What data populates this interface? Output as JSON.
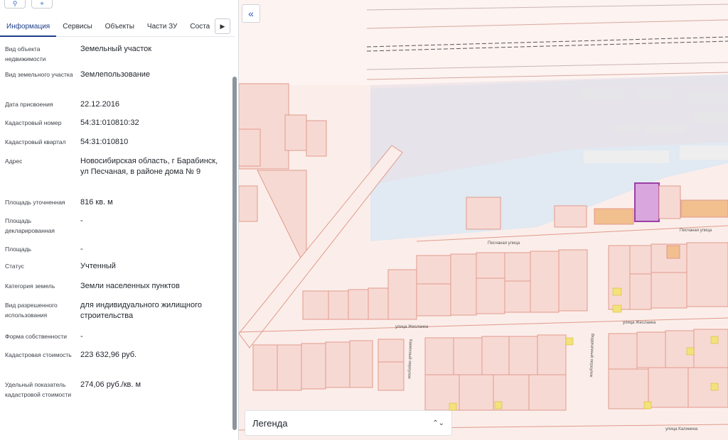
{
  "toolbar": {
    "zoom_icon": "zoom-in-icon",
    "pin_icon": "pin-icon"
  },
  "tabs": [
    {
      "label": "Информация",
      "active": true
    },
    {
      "label": "Сервисы",
      "active": false
    },
    {
      "label": "Объекты",
      "active": false
    },
    {
      "label": "Части ЗУ",
      "active": false
    },
    {
      "label": "Соста",
      "active": false
    }
  ],
  "info": [
    {
      "label": "Вид объекта недвижимости",
      "value": "Земельный участок"
    },
    {
      "label": "Вид земельного участка",
      "value": "Землепользование"
    },
    {
      "label": "Дата присвоения",
      "value": "22.12.2016"
    },
    {
      "label": "Кадастровый номер",
      "value": "54:31:010810:32"
    },
    {
      "label": "Кадастровый квартал",
      "value": "54:31:010810"
    },
    {
      "label": "Адрес",
      "value": "Новосибирская область, г Барабинск, ул Песчаная, в районе дома № 9"
    },
    {
      "label": "Площадь уточненная",
      "value": "816 кв. м"
    },
    {
      "label": "Площадь декларированная",
      "value": "-"
    },
    {
      "label": "Площадь",
      "value": "-"
    },
    {
      "label": "Статус",
      "value": "Учтенный"
    },
    {
      "label": "Категория земель",
      "value": "Земли населенных пунктов"
    },
    {
      "label": "Вид разрешенного использования",
      "value": "для индивидуального жилищного строительства"
    },
    {
      "label": "Форма собственности",
      "value": "-"
    },
    {
      "label": "Кадастровая стоимость",
      "value": "223 632,96 руб."
    },
    {
      "label": "Удельный показатель кадастровой стоимости",
      "value": "274,06 руб./кв. м"
    }
  ],
  "map": {
    "collapse_icon": "double-chevron-left-icon",
    "legend_label": "Легенда",
    "legend_toggle_icon": "chevron-up-down-icon",
    "streets": {
      "peschanaya_top": "Песчаная улица",
      "peschanaya_left": "Песчаная улица",
      "yuzhnaya_left": "улица Жесланка",
      "yuzhnaya_right": "улица Жесланка",
      "lane_1": "Каменный переулок",
      "lane_2": "Водокачный переулок",
      "kalinina": "улица Калинина"
    },
    "colors": {
      "parcel_fill": "#f7d9d3",
      "parcel_stroke": "#e09a8c",
      "selected_fill": "#d9a6de",
      "selected_stroke": "#9a3fa6",
      "water": "#dce8f3",
      "orange_parcel": "#f2bf8f",
      "yellow_marker": "#f3e27a"
    }
  }
}
